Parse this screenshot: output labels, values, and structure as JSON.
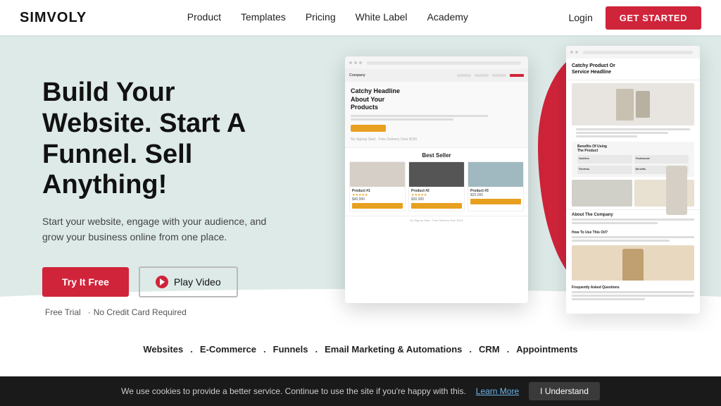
{
  "brand": {
    "logo": "SIMVOLY"
  },
  "nav": {
    "links": [
      {
        "label": "Product",
        "href": "#"
      },
      {
        "label": "Templates",
        "href": "#"
      },
      {
        "label": "Pricing",
        "href": "#"
      },
      {
        "label": "White Label",
        "href": "#"
      },
      {
        "label": "Academy",
        "href": "#"
      }
    ],
    "login_label": "Login",
    "cta_label": "GET STARTED"
  },
  "hero": {
    "headline": "Build Your Website. Start A Funnel. Sell Anything!",
    "subtext": "Start your website, engage with your audience, and grow your business online from one place.",
    "btn_try": "Try It Free",
    "btn_play": "Play Video",
    "note1": "Free Trial",
    "note2": "No Credit Card Required"
  },
  "features": {
    "items": [
      "Websites",
      "E-Commerce",
      "Funnels",
      "Email Marketing & Automations",
      "CRM",
      "Appointments"
    ]
  },
  "cookie": {
    "text": "We use cookies to provide a better service. Continue to use the site if you're happy with this.",
    "link_label": "Learn More",
    "btn_label": "I Understand"
  },
  "mockup_main": {
    "headline": "Catchy Headline\nAbout Your\nProducts",
    "section_title": "Best Seller",
    "product1": {
      "name": "Product #1",
      "price": "$40,000"
    },
    "product2": {
      "name": "Product #2",
      "price": "$30,000"
    }
  },
  "mockup_secondary": {
    "headline": "Catchy Product Or\nService Headline",
    "about_label": "About The Company",
    "faq_label": "Frequently Asked Questions"
  }
}
